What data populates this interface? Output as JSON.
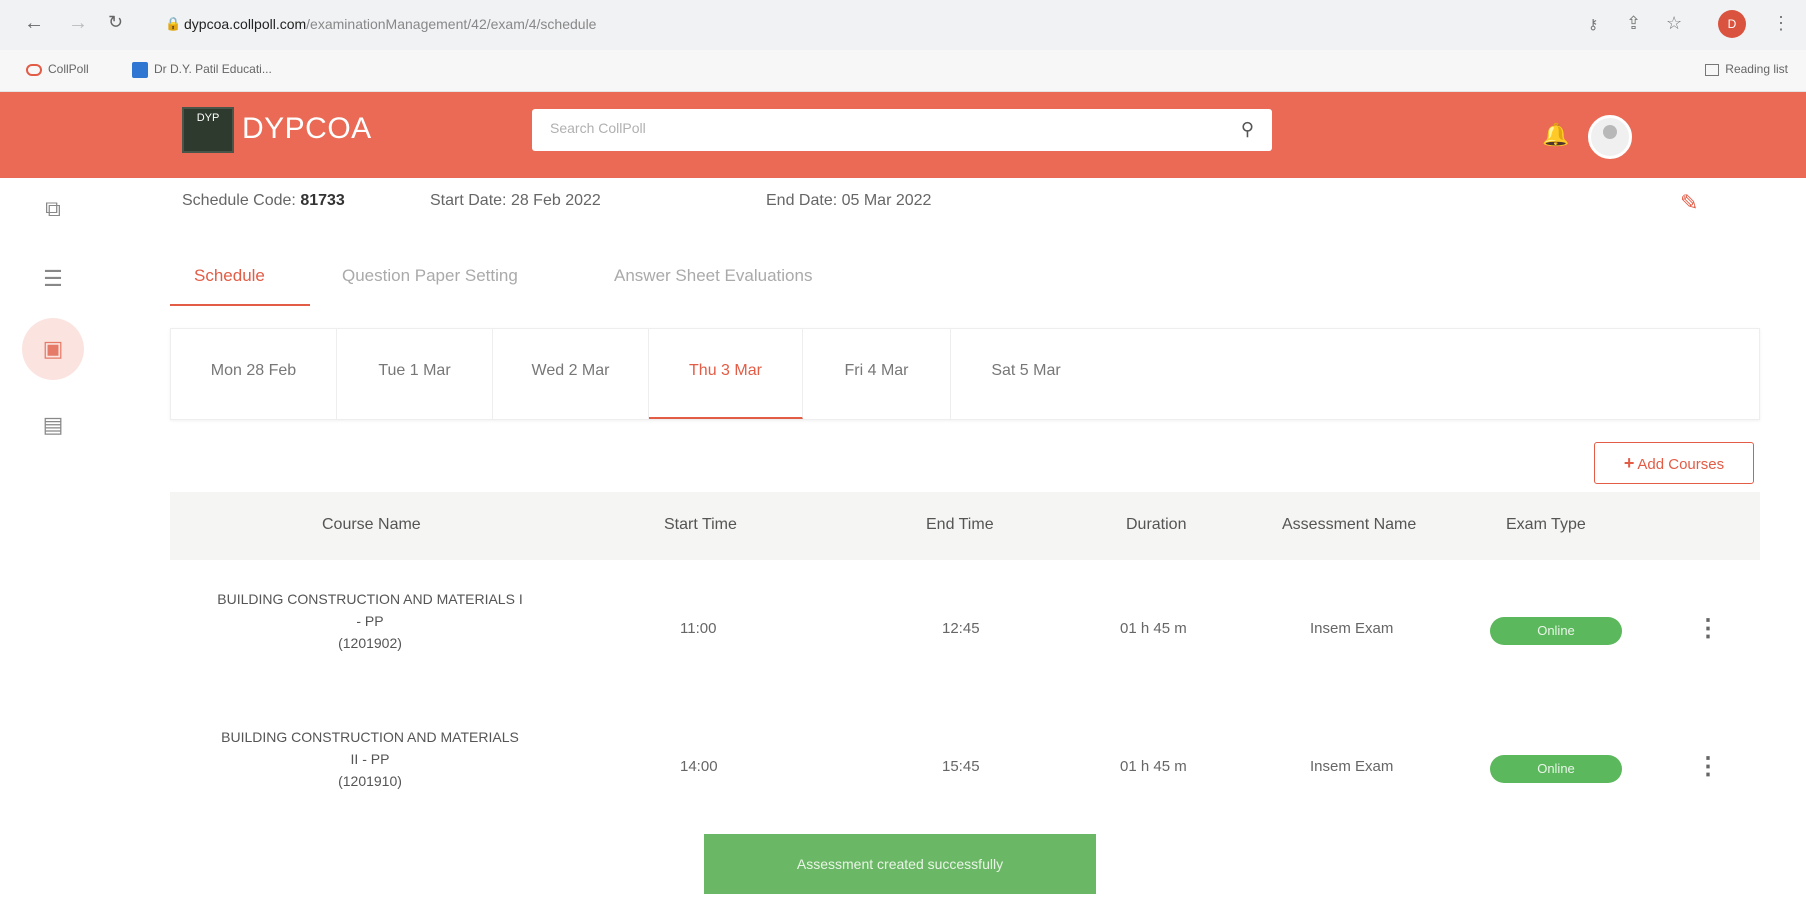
{
  "browser": {
    "url_domain": "dypcoa.collpoll.com",
    "url_path": "/examinationManagement/42/exam/4/schedule",
    "bookmarks": [
      "CollPoll",
      "Dr D.Y. Patil Educati..."
    ],
    "reading_list": "Reading list",
    "profile_initial": "D"
  },
  "header": {
    "logo_text": "DYP",
    "brand": "DYPCOA",
    "search_placeholder": "Search CollPoll"
  },
  "schedule": {
    "code_label": "Schedule Code:",
    "code_value": "81733",
    "start_label": "Start Date:",
    "start_value": "28 Feb 2022",
    "end_label": "End Date:",
    "end_value": "05 Mar 2022"
  },
  "tabs": [
    {
      "label": "Schedule"
    },
    {
      "label": "Question Paper Setting"
    },
    {
      "label": "Answer Sheet Evaluations"
    }
  ],
  "days": [
    "Mon 28 Feb",
    "Tue 1 Mar",
    "Wed 2 Mar",
    "Thu 3 Mar",
    "Fri 4 Mar",
    "Sat 5 Mar"
  ],
  "active_day": "Thu 3 Mar",
  "add_button": "Add Courses",
  "table": {
    "columns": [
      "Course Name",
      "Start Time",
      "End Time",
      "Duration",
      "Assessment Name",
      "Exam Type"
    ],
    "rows": [
      {
        "course_line1": "BUILDING CONSTRUCTION AND MATERIALS I",
        "course_line2": "- PP",
        "course_code": "(1201902)",
        "start": "11:00",
        "end": "12:45",
        "duration": "01 h 45 m",
        "assessment": "Insem Exam",
        "exam_type": "Online"
      },
      {
        "course_line1": "BUILDING CONSTRUCTION AND MATERIALS",
        "course_line2": "II - PP",
        "course_code": "(1201910)",
        "start": "14:00",
        "end": "15:45",
        "duration": "01 h 45 m",
        "assessment": "Insem Exam",
        "exam_type": "Online"
      }
    ]
  },
  "toast": "Assessment created successfully",
  "colors": {
    "brand": "#ea6a55",
    "accent": "#e25c46",
    "success": "#5cb85c"
  }
}
